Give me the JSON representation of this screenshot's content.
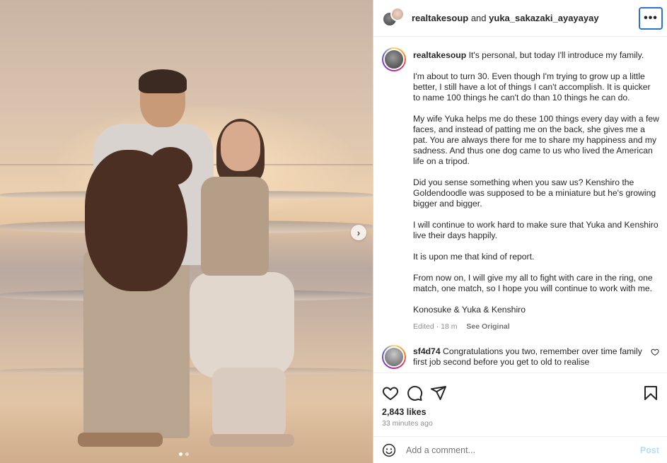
{
  "header": {
    "author": "realtakesoup",
    "joiner": "and",
    "coauthor": "yuka_sakazaki_ayayayay",
    "more_label": "•••"
  },
  "media": {
    "next_label": "›",
    "dots": 2,
    "active_dot": 1
  },
  "caption": {
    "username": "realtakesoup",
    "paragraphs": [
      "It's personal, but today I'll introduce my family.",
      "I'm about to turn 30. Even though I'm trying to grow up a little better, I still have a lot of things I can't accomplish. It is quicker to name 100 things he can't do than 10 things he can do.",
      "My wife Yuka helps me do these 100 things every day with a few faces, and instead of patting me on the back, she gives me a pat. You are always there for me to share my happiness and my sadness. And thus one dog came to us who lived the American life on a tripod.",
      "Did you sense something when you saw us? Kenshiro the Goldendoodle was supposed to be a miniature but he's growing bigger and bigger.",
      "I will continue to work hard to make sure that Yuka and Kenshiro live their days happily.",
      "It is upon me that kind of report.",
      "From now on, I will give my all to fight with care in the ring, one match, one match, so I hope you will continue to work with me.",
      "Konosuke & Yuka & Kenshiro"
    ],
    "edited": "Edited · 18 m",
    "see_original": "See Original"
  },
  "comments": [
    {
      "username": "sf4d74",
      "text": "Congratulations you two, remember over time family first job second before you get to old to realise"
    }
  ],
  "actions": {
    "likes": "2,843 likes",
    "time": "33 minutes ago"
  },
  "composer": {
    "placeholder": "Add a comment...",
    "post_label": "Post"
  },
  "colors": {
    "accent": "#0095f6",
    "post_disabled": "#b2dffc",
    "focus_outline": "#2f6fd6"
  }
}
